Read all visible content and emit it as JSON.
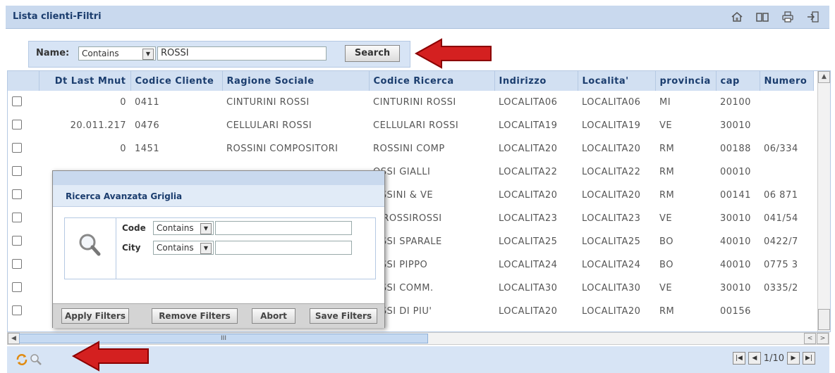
{
  "window": {
    "title": "Lista clienti-Filtri"
  },
  "toolbar": {
    "icons": [
      "home-icon",
      "book-icon",
      "printer-icon",
      "exit-icon"
    ]
  },
  "search": {
    "label": "Name:",
    "operator": "Contains",
    "value": "ROSSI",
    "button": "Search"
  },
  "grid": {
    "columns": [
      "Dt Last Mnut",
      "Codice Cliente",
      "Ragione Sociale",
      "Codice Ricerca",
      "Indirizzo",
      "Localita'",
      "provincia",
      "cap",
      "Numero"
    ],
    "rows": [
      {
        "dt": "0",
        "codice": "0411",
        "ragione": "CINTURINI ROSSI",
        "ricerca": "CINTURINI ROSSI",
        "indirizzo": "LOCALITA06",
        "localita": "LOCALITA06",
        "provincia": "MI",
        "cap": "20100",
        "numero": ""
      },
      {
        "dt": "20.011.217",
        "codice": "0476",
        "ragione": "CELLULARI ROSSI",
        "ricerca": "CELLULARI ROSSI",
        "indirizzo": "LOCALITA19",
        "localita": "LOCALITA19",
        "provincia": "VE",
        "cap": "30010",
        "numero": ""
      },
      {
        "dt": "0",
        "codice": "1451",
        "ragione": "ROSSINI COMPOSITORI",
        "ricerca": "ROSSINI COMP",
        "indirizzo": "LOCALITA20",
        "localita": "LOCALITA20",
        "provincia": "RM",
        "cap": "00188",
        "numero": "06/334"
      },
      {
        "dt": "",
        "codice": "",
        "ragione": "",
        "ricerca": "OSSI GIALLI",
        "indirizzo": "LOCALITA22",
        "localita": "LOCALITA22",
        "provincia": "RM",
        "cap": "00010",
        "numero": ""
      },
      {
        "dt": "",
        "codice": "",
        "ragione": "",
        "ricerca": "OSSINI & VE",
        "indirizzo": "LOCALITA20",
        "localita": "LOCALITA20",
        "provincia": "RM",
        "cap": "00141",
        "numero": "06 871"
      },
      {
        "dt": "",
        "codice": "",
        "ragione": "",
        "ricerca": "E ROSSIROSSI",
        "indirizzo": "LOCALITA23",
        "localita": "LOCALITA23",
        "provincia": "VE",
        "cap": "30010",
        "numero": "041/54"
      },
      {
        "dt": "",
        "codice": "",
        "ragione": "",
        "ricerca": "OSSI SPARALE",
        "indirizzo": "LOCALITA25",
        "localita": "LOCALITA25",
        "provincia": "BO",
        "cap": "40010",
        "numero": "0422/7"
      },
      {
        "dt": "",
        "codice": "",
        "ragione": "",
        "ricerca": "OSSI PIPPO",
        "indirizzo": "LOCALITA24",
        "localita": "LOCALITA24",
        "provincia": "BO",
        "cap": "40010",
        "numero": "0775 3"
      },
      {
        "dt": "",
        "codice": "",
        "ragione": "",
        "ricerca": "OSSI COMM.",
        "indirizzo": "LOCALITA30",
        "localita": "LOCALITA30",
        "provincia": "VE",
        "cap": "30010",
        "numero": "0335/2"
      },
      {
        "dt": "",
        "codice": "",
        "ragione": "",
        "ricerca": "OSSI DI PIU'",
        "indirizzo": "LOCALITA20",
        "localita": "LOCALITA20",
        "provincia": "RM",
        "cap": "00156",
        "numero": ""
      }
    ]
  },
  "dialog": {
    "title": "Ricerca Avanzata Griglia",
    "fields": [
      {
        "label": "Code",
        "operator": "Contains",
        "value": ""
      },
      {
        "label": "City",
        "operator": "Contains",
        "value": ""
      }
    ],
    "buttons": [
      "Apply Filters",
      "Remove Filters",
      "Abort",
      "Save Filters"
    ]
  },
  "pager": {
    "text": "1/10"
  },
  "footer": {
    "icons": [
      "refresh-icon",
      "search-icon"
    ]
  },
  "colors": {
    "header_bg": "#c9d9ee",
    "accent": "#1b3d6e",
    "arrow": "#d42020"
  }
}
